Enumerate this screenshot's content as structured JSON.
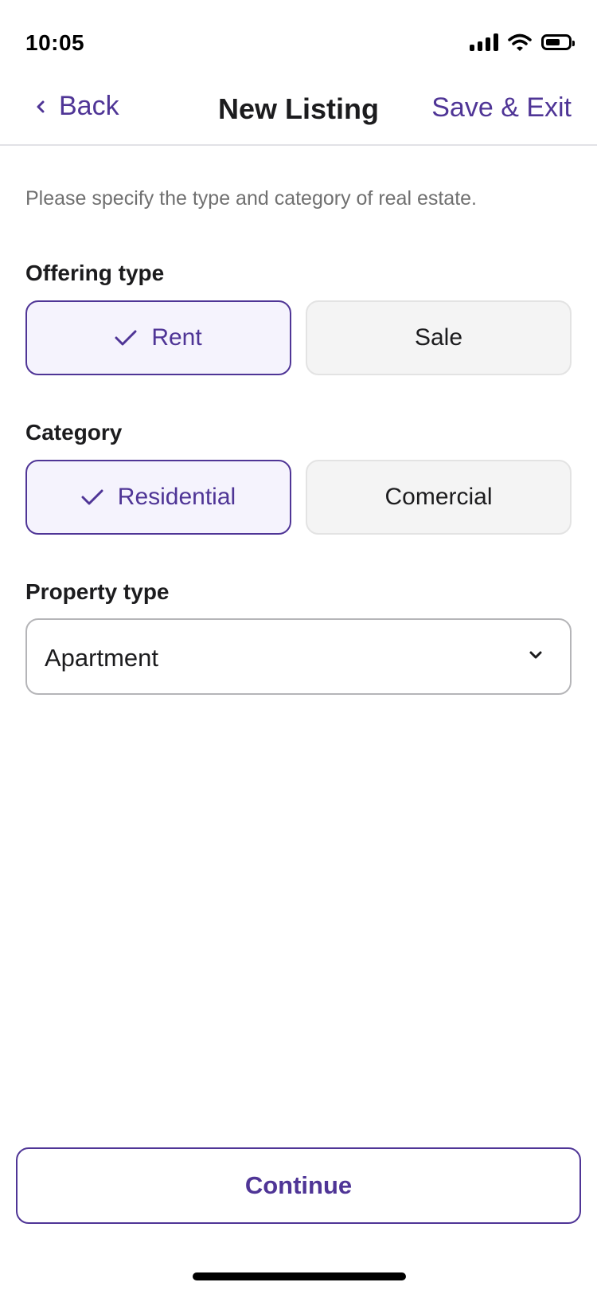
{
  "status_bar": {
    "time": "10:05",
    "icons": [
      "signal-icon",
      "wifi-icon",
      "battery-icon"
    ]
  },
  "nav": {
    "back_label": "Back",
    "title": "New Listing",
    "save_exit_label": "Save & Exit"
  },
  "instructions": "Please specify the type and category of real estate.",
  "offering_type": {
    "label": "Offering type",
    "options": [
      {
        "label": "Rent",
        "selected": true
      },
      {
        "label": "Sale",
        "selected": false
      }
    ]
  },
  "category": {
    "label": "Category",
    "options": [
      {
        "label": "Residential",
        "selected": true
      },
      {
        "label": "Comercial",
        "selected": false
      }
    ]
  },
  "property_type": {
    "label": "Property type",
    "value": "Apartment"
  },
  "continue_label": "Continue",
  "colors": {
    "accent": "#4f3596",
    "selected_bg": "#f5f3fd",
    "unselected_bg": "#f4f4f4",
    "muted_text": "#707070"
  }
}
